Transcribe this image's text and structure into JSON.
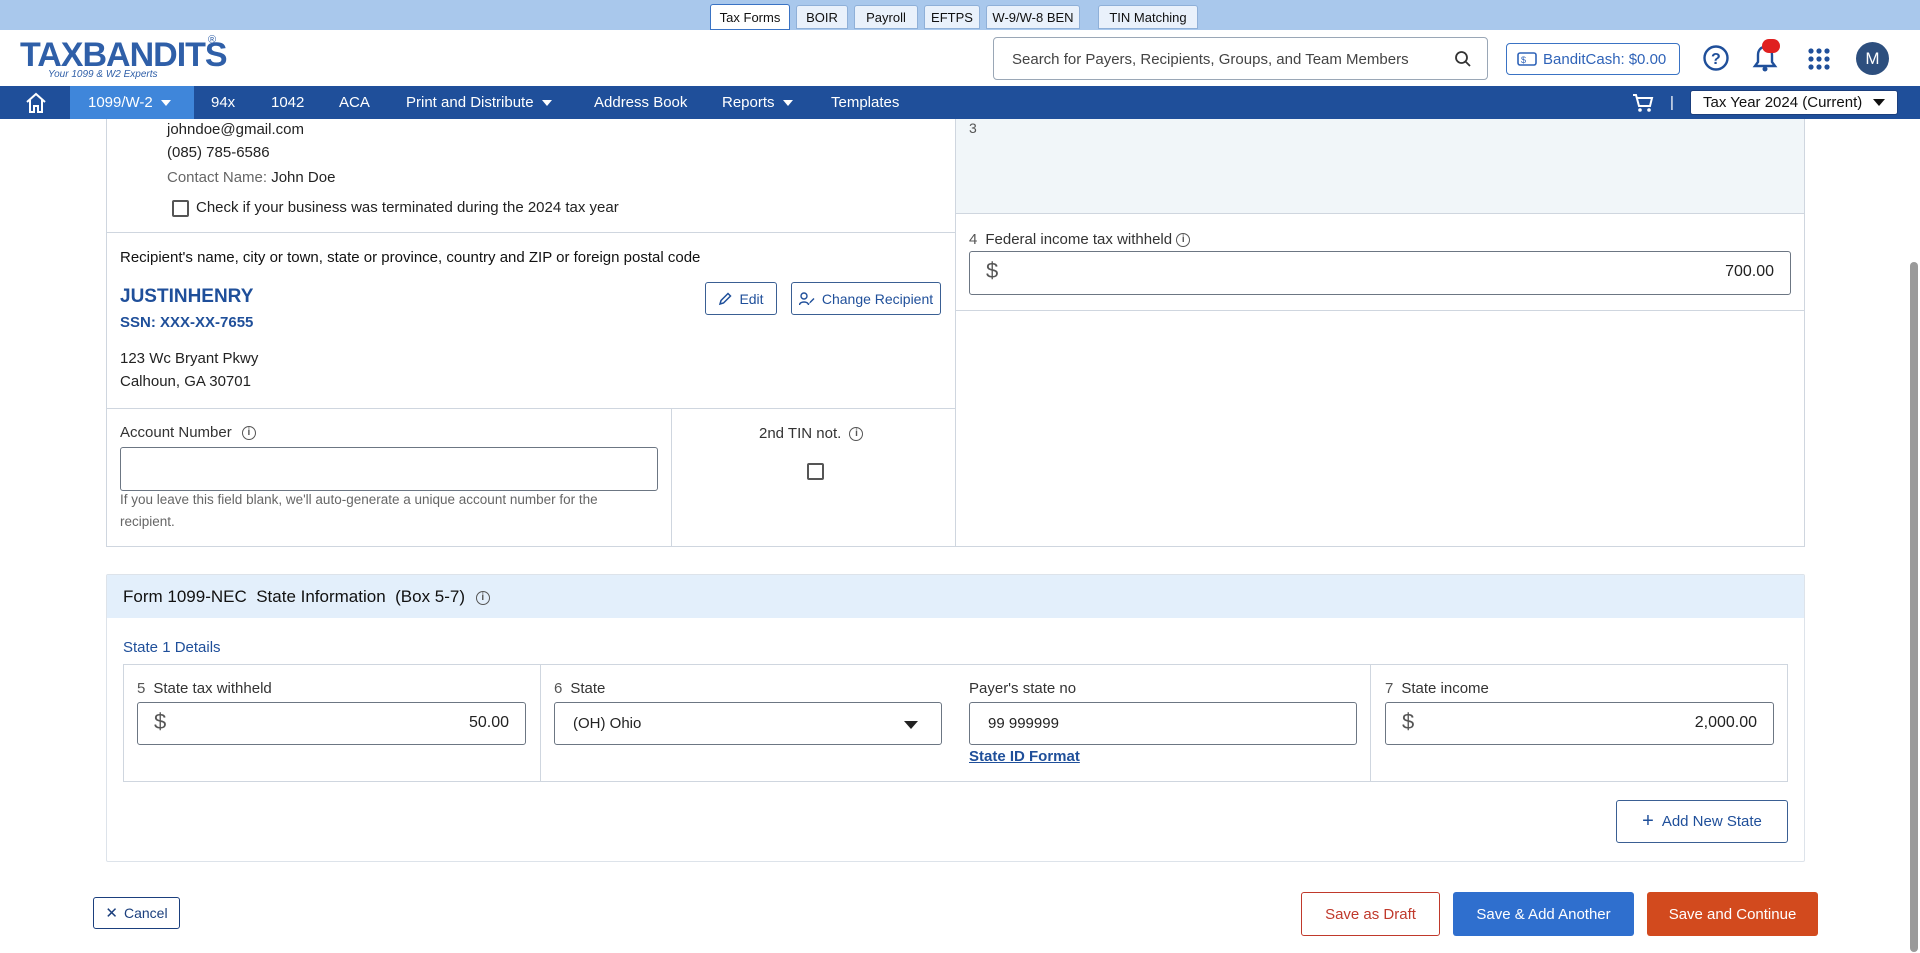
{
  "product_tabs": [
    "Tax Forms",
    "BOIR",
    "Payroll",
    "EFTPS",
    "W-9/W-8 BEN",
    "TIN Matching"
  ],
  "logo": {
    "brand": "TAXBANDITS",
    "tagline": "Your 1099 & W2 Experts",
    "registered": "®"
  },
  "search": {
    "placeholder": "Search for Payers, Recipients, Groups, and Team Members"
  },
  "header": {
    "banditcash_label": "BanditCash:",
    "banditcash_amount": "$0.00",
    "avatar_initial": "M"
  },
  "nav": {
    "items": [
      {
        "label": "1099/W-2",
        "dropdown": true
      },
      {
        "label": "94x"
      },
      {
        "label": "1042"
      },
      {
        "label": "ACA"
      },
      {
        "label": "Print and Distribute",
        "dropdown": true
      },
      {
        "label": "Address Book"
      },
      {
        "label": "Reports",
        "dropdown": true
      },
      {
        "label": "Templates"
      }
    ],
    "separator": "|",
    "tax_year": "Tax Year 2024 (Current)"
  },
  "payer": {
    "email": "johndoe@gmail.com",
    "phone": "(085) 785-6586",
    "contact_label": "Contact Name:",
    "contact_name": "John Doe",
    "terminated_label": "Check if your business was terminated during the 2024 tax year"
  },
  "recipient": {
    "section_label": "Recipient's name, city or town, state or province, country and ZIP or foreign postal code",
    "name": "JUSTINHENRY",
    "ssn": "SSN: XXX-XX-7655",
    "address1": "123 Wc Bryant Pkwy",
    "address2": "Calhoun, GA 30701",
    "edit_label": "Edit",
    "change_label": "Change Recipient"
  },
  "account": {
    "label": "Account Number",
    "value": "",
    "hint_line1": "If you leave this field blank, we'll auto-generate a unique account number for the",
    "hint_line2": "recipient."
  },
  "tin": {
    "label": "2nd TIN not."
  },
  "box3": {
    "number": "3"
  },
  "box4": {
    "number": "4",
    "label": "Federal income tax withheld",
    "currency": "$",
    "value": "700.00"
  },
  "state_section": {
    "title": "Form 1099-NEC  State Information  (Box 5-7)",
    "details_label": "State 1 Details",
    "box5": {
      "number": "5",
      "label": "State tax withheld",
      "currency": "$",
      "value": "50.00"
    },
    "box6": {
      "number": "6",
      "label": "State",
      "value": "(OH) Ohio"
    },
    "payer_state_no": {
      "label": "Payer's state no",
      "value": "99 999999",
      "format_link": "State ID Format"
    },
    "box7": {
      "number": "7",
      "label": "State income",
      "currency": "$",
      "value": "2,000.00"
    },
    "add_state_label": "Add New State"
  },
  "footer": {
    "cancel": "Cancel",
    "save_draft": "Save as Draft",
    "save_add": "Save & Add Another",
    "save_continue": "Save and Continue"
  },
  "colors": {
    "nav": "#1f4f9a",
    "nav_active": "#3f86da",
    "primary": "#2f6fce",
    "continue": "#d24a1e",
    "draft": "#c0392b"
  }
}
